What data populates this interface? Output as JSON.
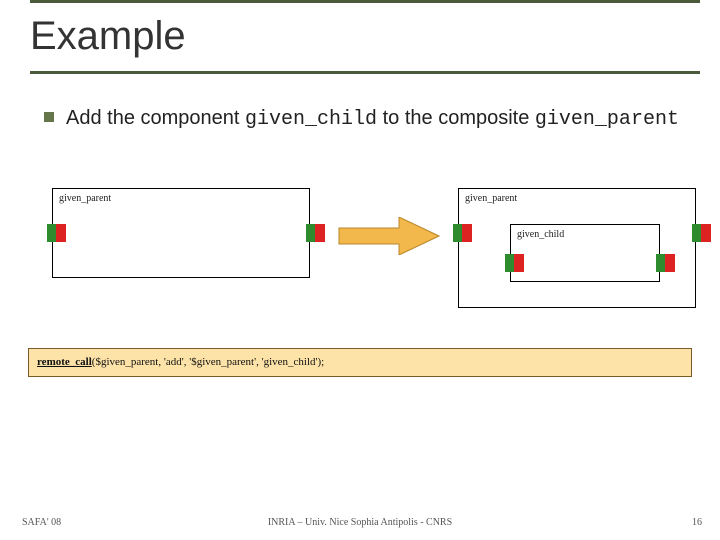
{
  "title": "Example",
  "bullet": {
    "text_pre": "Add the component ",
    "code1": "given_child",
    "text_mid": " to the composite ",
    "code2": "given_parent"
  },
  "boxes": {
    "left_parent_label": "given_parent",
    "right_parent_label": "given_parent",
    "child_label": "given_child"
  },
  "code": {
    "fn": "remote_call",
    "args": "($given_parent, 'add', '$given_parent', 'given_child');"
  },
  "footer": {
    "left": "SAFA' 08",
    "center": "INRIA – Univ. Nice Sophia Antipolis - CNRS",
    "page": "16"
  },
  "colors": {
    "rule": "#4a5a3a",
    "bullet": "#64764a",
    "codebox_bg": "#fde3a7",
    "codebox_border": "#7a5a2a",
    "arrow_fill": "#f2b84b",
    "arrow_stroke": "#b9862c",
    "port_green": "#2e8b2e",
    "port_red": "#d22"
  }
}
